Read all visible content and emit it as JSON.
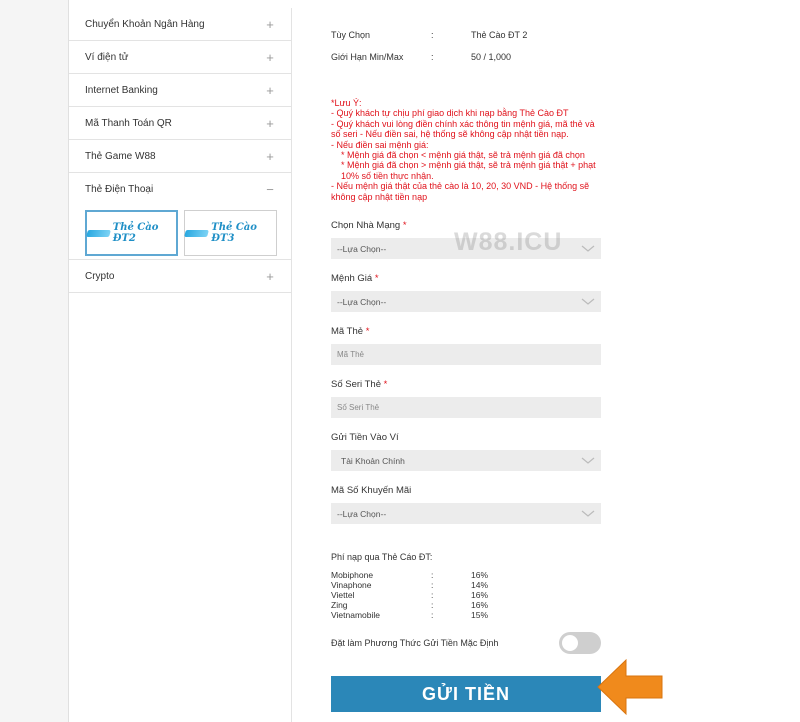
{
  "sidebar": {
    "items_top": [
      {
        "label": "Chuyển Khoản Ngân Hàng",
        "sign": "+"
      },
      {
        "label": "Ví điện tử",
        "sign": "+"
      },
      {
        "label": "Internet Banking",
        "sign": "+"
      },
      {
        "label": "Mã Thanh Toán QR",
        "sign": "+"
      },
      {
        "label": "Thẻ Game W88",
        "sign": "+"
      },
      {
        "label": "Thẻ Điện Thoại",
        "sign": "−"
      }
    ],
    "cards": [
      {
        "label": "Thẻ Cào ĐT2",
        "selected": true
      },
      {
        "label": "Thẻ Cào ĐT3",
        "selected": false
      }
    ],
    "item_bottom": {
      "label": "Crypto",
      "sign": "+"
    }
  },
  "info": {
    "option_label": "Tùy Chọn",
    "option_value": "Thẻ Cào ĐT 2",
    "limit_label": "Giới Hạn Min/Max",
    "limit_value": "50 / 1,000",
    "colon": ":"
  },
  "note": {
    "title": "*Lưu Ý:",
    "lines": [
      "- Quý khách tự chịu phí giao dịch khi nạp bằng Thẻ Cào ĐT",
      "- Quý khách vui lòng điền chính xác thông tin mệnh giá, mã thẻ và số seri - Nếu điền sai, hệ thống sẽ không cập nhật tiền nạp.",
      "- Nếu điền sai mệnh giá:",
      "   * Mệnh giá đã chọn < mệnh giá thật, sẽ trả mệnh giá đã chọn",
      "   * Mệnh giá đã chọn > mệnh giá thật, sẽ trả mệnh giá thật + phạt 10% số tiền thực nhận.",
      "- Nếu mệnh giá thật của thẻ cào là 10, 20, 30 VND - Hệ thống sẽ không cập nhật tiền nạp"
    ]
  },
  "watermark": "W88.ICU",
  "form": {
    "network_label": "Chọn Nhà Mạng",
    "network_value": "--Lựa Chọn--",
    "denom_label": "Mệnh Giá",
    "denom_value": "--Lựa Chọn--",
    "code_label": "Mã Thẻ",
    "code_placeholder": "Mã Thẻ",
    "serial_label": "Số Seri Thẻ",
    "serial_placeholder": "Số Seri Thẻ",
    "wallet_label": "Gửi Tiền Vào Ví",
    "wallet_value": "Tài Khoản Chính",
    "promo_label": "Mã Số Khuyến Mãi",
    "promo_value": "--Lựa Chọn--",
    "required_mark": "*"
  },
  "fees": {
    "title": "Phí nạp qua Thẻ Cáo ĐT:",
    "rows": [
      {
        "name": "Mobiphone",
        "value": "16%"
      },
      {
        "name": "Vinaphone",
        "value": "14%"
      },
      {
        "name": "Viettel",
        "value": "16%"
      },
      {
        "name": "Zing",
        "value": "16%"
      },
      {
        "name": "Vietnamobile",
        "value": "15%"
      }
    ]
  },
  "default_toggle": {
    "label": "Đặt làm Phương Thức Gửi Tiền Mặc Định",
    "on": false
  },
  "submit_label": "GỬI TIỀN",
  "colors": {
    "note": "#e0121b",
    "submit": "#2b87b8",
    "arrow": "#f08a1c"
  }
}
